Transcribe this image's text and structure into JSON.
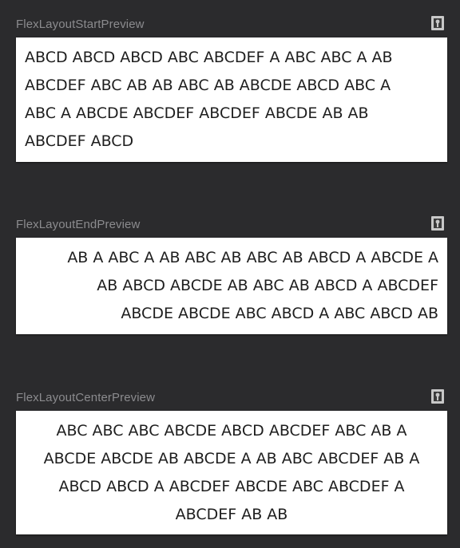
{
  "previews": [
    {
      "title": "FlexLayoutStartPreview",
      "icon": "preview-pin-icon",
      "align": "start",
      "lines": [
        "ABCD ABCD ABCD ABC ABCDEF A ABC ABC A AB",
        "ABCDEF ABC AB AB ABC AB ABCDE ABCD ABC A",
        "ABC A ABCDE ABCDEF ABCDEF ABCDE AB AB",
        "ABCDEF ABCD"
      ]
    },
    {
      "title": "FlexLayoutEndPreview",
      "icon": "preview-pin-icon",
      "align": "end",
      "lines": [
        "AB A ABC A AB ABC AB ABC AB ABCD A ABCDE A",
        "AB ABCD ABCDE AB ABC AB ABCD A ABCDEF",
        "ABCDE ABCDE ABC ABCD A ABC ABCD AB"
      ]
    },
    {
      "title": "FlexLayoutCenterPreview",
      "icon": "preview-pin-icon",
      "align": "center",
      "lines": [
        "ABC ABC ABC ABCDE ABCD ABCDEF ABC AB A",
        "ABCDE ABCDE AB ABCDE A AB ABC ABCDEF AB A",
        "ABCD ABCD A ABCDEF ABCDE ABC ABCDEF A",
        "ABCDEF AB AB"
      ]
    }
  ],
  "colors": {
    "background": "#2b2b2d",
    "title_text": "#8b8b8e",
    "card_background": "#ffffff",
    "card_text": "#1e1e1e",
    "icon_background": "#c8c8c8"
  }
}
